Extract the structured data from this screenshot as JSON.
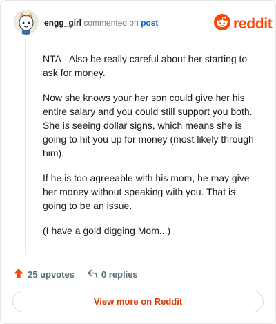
{
  "comment": {
    "username": "engg_girl",
    "commented_on_text": "commented on",
    "post_link": "post",
    "paragraphs": [
      "NTA - Also be really careful about her starting to ask for money.",
      "Now she knows your her son could give her his entire salary and you could still support you both. She is seeing dollar signs, which means she is going to hit you up for money (most likely through him).",
      "If he is too agreeable with his mom, he may give her money without speaking with you. That is going to be an issue.",
      "(I have a gold digging Mom...)"
    ]
  },
  "brand": {
    "name": "reddit",
    "icon": "reddit-logo-icon",
    "color": "#ff4500"
  },
  "actions": {
    "upvotes": "25 upvotes",
    "replies": "0 replies",
    "upvote_icon": "upvote-arrow-icon",
    "reply_icon": "reply-arrow-icon",
    "upvote_color": "#ff4500"
  },
  "footer": {
    "view_more_label": "View more on Reddit",
    "accent": "#d93a00"
  }
}
